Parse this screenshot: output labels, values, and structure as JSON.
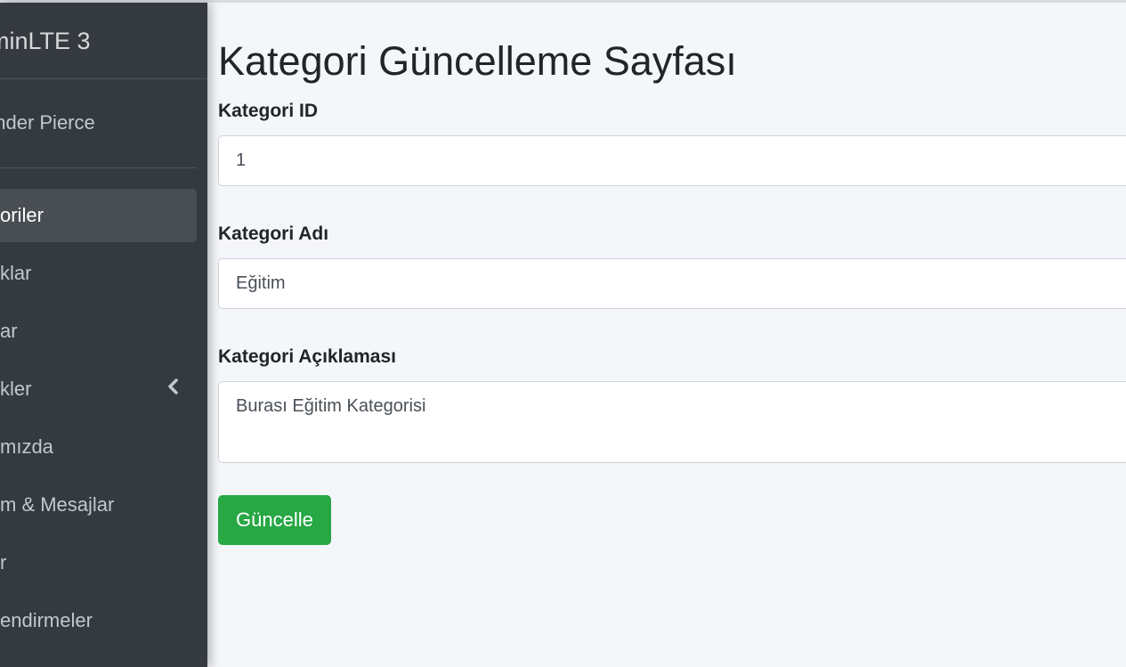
{
  "sidebar": {
    "brand": "minLTE 3",
    "user_name": "ander Pierce",
    "items": [
      {
        "label": "oriler",
        "active": true
      },
      {
        "label": "klar",
        "active": false
      },
      {
        "label": "ar",
        "active": false
      },
      {
        "label": "kler",
        "active": false,
        "icon": "chevron-left-icon"
      },
      {
        "label": "mızda",
        "active": false
      },
      {
        "label": "m & Mesajlar",
        "active": false
      },
      {
        "label": "r",
        "active": false
      },
      {
        "label": "endirmeler",
        "active": false
      }
    ]
  },
  "main": {
    "title": "Kategori Güncelleme Sayfası",
    "fields": {
      "id": {
        "label": "Kategori ID",
        "value": "1"
      },
      "name": {
        "label": "Kategori Adı",
        "value": "Eğitim"
      },
      "description": {
        "label": "Kategori Açıklaması",
        "value": "Burası Eğitim Kategorisi"
      }
    },
    "submit_label": "Güncelle"
  },
  "colors": {
    "sidebar_bg": "#343a40",
    "content_bg": "#f4f6f9",
    "button_success": "#28a745"
  }
}
